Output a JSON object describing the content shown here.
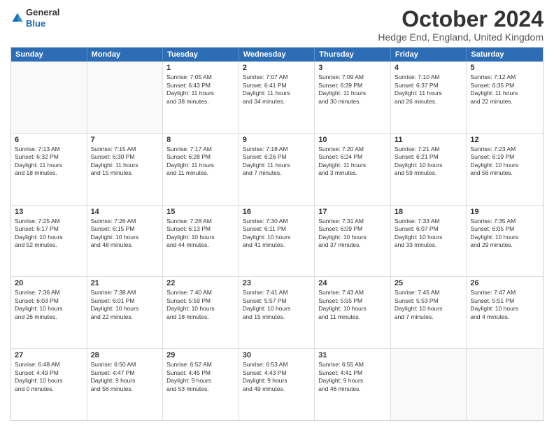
{
  "header": {
    "logo_general": "General",
    "logo_blue": "Blue",
    "month_title": "October 2024",
    "subtitle": "Hedge End, England, United Kingdom"
  },
  "calendar": {
    "days_of_week": [
      "Sunday",
      "Monday",
      "Tuesday",
      "Wednesday",
      "Thursday",
      "Friday",
      "Saturday"
    ],
    "rows": [
      [
        {
          "day": "",
          "lines": [],
          "empty": true
        },
        {
          "day": "",
          "lines": [],
          "empty": true
        },
        {
          "day": "1",
          "lines": [
            "Sunrise: 7:05 AM",
            "Sunset: 6:43 PM",
            "Daylight: 11 hours",
            "and 38 minutes."
          ]
        },
        {
          "day": "2",
          "lines": [
            "Sunrise: 7:07 AM",
            "Sunset: 6:41 PM",
            "Daylight: 11 hours",
            "and 34 minutes."
          ]
        },
        {
          "day": "3",
          "lines": [
            "Sunrise: 7:09 AM",
            "Sunset: 6:39 PM",
            "Daylight: 11 hours",
            "and 30 minutes."
          ]
        },
        {
          "day": "4",
          "lines": [
            "Sunrise: 7:10 AM",
            "Sunset: 6:37 PM",
            "Daylight: 11 hours",
            "and 26 minutes."
          ]
        },
        {
          "day": "5",
          "lines": [
            "Sunrise: 7:12 AM",
            "Sunset: 6:35 PM",
            "Daylight: 11 hours",
            "and 22 minutes."
          ]
        }
      ],
      [
        {
          "day": "6",
          "lines": [
            "Sunrise: 7:13 AM",
            "Sunset: 6:32 PM",
            "Daylight: 11 hours",
            "and 18 minutes."
          ]
        },
        {
          "day": "7",
          "lines": [
            "Sunrise: 7:15 AM",
            "Sunset: 6:30 PM",
            "Daylight: 11 hours",
            "and 15 minutes."
          ]
        },
        {
          "day": "8",
          "lines": [
            "Sunrise: 7:17 AM",
            "Sunset: 6:28 PM",
            "Daylight: 11 hours",
            "and 11 minutes."
          ]
        },
        {
          "day": "9",
          "lines": [
            "Sunrise: 7:18 AM",
            "Sunset: 6:26 PM",
            "Daylight: 11 hours",
            "and 7 minutes."
          ]
        },
        {
          "day": "10",
          "lines": [
            "Sunrise: 7:20 AM",
            "Sunset: 6:24 PM",
            "Daylight: 11 hours",
            "and 3 minutes."
          ]
        },
        {
          "day": "11",
          "lines": [
            "Sunrise: 7:21 AM",
            "Sunset: 6:21 PM",
            "Daylight: 10 hours",
            "and 59 minutes."
          ]
        },
        {
          "day": "12",
          "lines": [
            "Sunrise: 7:23 AM",
            "Sunset: 6:19 PM",
            "Daylight: 10 hours",
            "and 56 minutes."
          ]
        }
      ],
      [
        {
          "day": "13",
          "lines": [
            "Sunrise: 7:25 AM",
            "Sunset: 6:17 PM",
            "Daylight: 10 hours",
            "and 52 minutes."
          ]
        },
        {
          "day": "14",
          "lines": [
            "Sunrise: 7:26 AM",
            "Sunset: 6:15 PM",
            "Daylight: 10 hours",
            "and 48 minutes."
          ]
        },
        {
          "day": "15",
          "lines": [
            "Sunrise: 7:28 AM",
            "Sunset: 6:13 PM",
            "Daylight: 10 hours",
            "and 44 minutes."
          ]
        },
        {
          "day": "16",
          "lines": [
            "Sunrise: 7:30 AM",
            "Sunset: 6:11 PM",
            "Daylight: 10 hours",
            "and 41 minutes."
          ]
        },
        {
          "day": "17",
          "lines": [
            "Sunrise: 7:31 AM",
            "Sunset: 6:09 PM",
            "Daylight: 10 hours",
            "and 37 minutes."
          ]
        },
        {
          "day": "18",
          "lines": [
            "Sunrise: 7:33 AM",
            "Sunset: 6:07 PM",
            "Daylight: 10 hours",
            "and 33 minutes."
          ]
        },
        {
          "day": "19",
          "lines": [
            "Sunrise: 7:35 AM",
            "Sunset: 6:05 PM",
            "Daylight: 10 hours",
            "and 29 minutes."
          ]
        }
      ],
      [
        {
          "day": "20",
          "lines": [
            "Sunrise: 7:36 AM",
            "Sunset: 6:03 PM",
            "Daylight: 10 hours",
            "and 26 minutes."
          ]
        },
        {
          "day": "21",
          "lines": [
            "Sunrise: 7:38 AM",
            "Sunset: 6:01 PM",
            "Daylight: 10 hours",
            "and 22 minutes."
          ]
        },
        {
          "day": "22",
          "lines": [
            "Sunrise: 7:40 AM",
            "Sunset: 5:59 PM",
            "Daylight: 10 hours",
            "and 18 minutes."
          ]
        },
        {
          "day": "23",
          "lines": [
            "Sunrise: 7:41 AM",
            "Sunset: 5:57 PM",
            "Daylight: 10 hours",
            "and 15 minutes."
          ]
        },
        {
          "day": "24",
          "lines": [
            "Sunrise: 7:43 AM",
            "Sunset: 5:55 PM",
            "Daylight: 10 hours",
            "and 11 minutes."
          ]
        },
        {
          "day": "25",
          "lines": [
            "Sunrise: 7:45 AM",
            "Sunset: 5:53 PM",
            "Daylight: 10 hours",
            "and 7 minutes."
          ]
        },
        {
          "day": "26",
          "lines": [
            "Sunrise: 7:47 AM",
            "Sunset: 5:51 PM",
            "Daylight: 10 hours",
            "and 4 minutes."
          ]
        }
      ],
      [
        {
          "day": "27",
          "lines": [
            "Sunrise: 6:48 AM",
            "Sunset: 4:49 PM",
            "Daylight: 10 hours",
            "and 0 minutes."
          ]
        },
        {
          "day": "28",
          "lines": [
            "Sunrise: 6:50 AM",
            "Sunset: 4:47 PM",
            "Daylight: 9 hours",
            "and 56 minutes."
          ]
        },
        {
          "day": "29",
          "lines": [
            "Sunrise: 6:52 AM",
            "Sunset: 4:45 PM",
            "Daylight: 9 hours",
            "and 53 minutes."
          ]
        },
        {
          "day": "30",
          "lines": [
            "Sunrise: 6:53 AM",
            "Sunset: 4:43 PM",
            "Daylight: 9 hours",
            "and 49 minutes."
          ]
        },
        {
          "day": "31",
          "lines": [
            "Sunrise: 6:55 AM",
            "Sunset: 4:41 PM",
            "Daylight: 9 hours",
            "and 46 minutes."
          ]
        },
        {
          "day": "",
          "lines": [],
          "empty": true
        },
        {
          "day": "",
          "lines": [],
          "empty": true
        }
      ]
    ]
  }
}
